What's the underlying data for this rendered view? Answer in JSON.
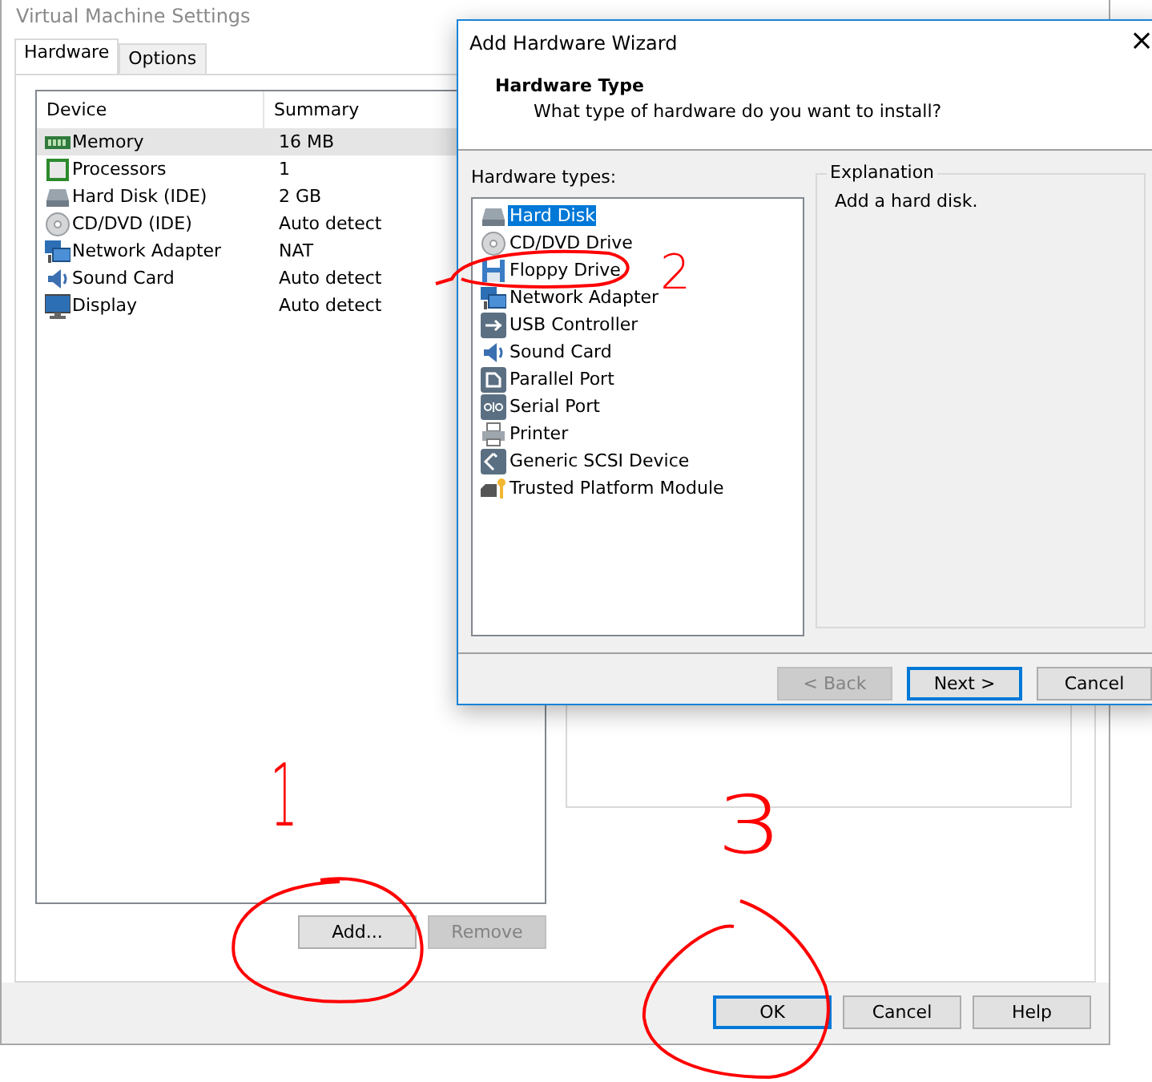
{
  "vm_window": {
    "title": "Virtual Machine Settings",
    "tabs": [
      {
        "label": "Hardware",
        "selected": true
      },
      {
        "label": "Options",
        "selected": false
      }
    ],
    "table": {
      "columns": [
        "Device",
        "Summary"
      ],
      "rows": [
        {
          "kind": "memory",
          "device": "Memory",
          "summary": "16 MB",
          "selected": true
        },
        {
          "kind": "cpu",
          "device": "Processors",
          "summary": "1",
          "selected": false
        },
        {
          "kind": "disk",
          "device": "Hard Disk (IDE)",
          "summary": "2 GB",
          "selected": false
        },
        {
          "kind": "cd",
          "device": "CD/DVD (IDE)",
          "summary": "Auto detect",
          "selected": false
        },
        {
          "kind": "network",
          "device": "Network Adapter",
          "summary": "NAT",
          "selected": false
        },
        {
          "kind": "sound",
          "device": "Sound Card",
          "summary": "Auto detect",
          "selected": false
        },
        {
          "kind": "display",
          "device": "Display",
          "summary": "Auto detect",
          "selected": false
        }
      ]
    },
    "list_buttons": [
      {
        "label": "Add...",
        "disabled": false
      },
      {
        "label": "Remove",
        "disabled": true
      }
    ],
    "buttons": [
      {
        "label": "OK",
        "default": true
      },
      {
        "label": "Cancel",
        "default": false
      },
      {
        "label": "Help",
        "default": false
      }
    ]
  },
  "wizard": {
    "title": "Add Hardware Wizard",
    "close": "×",
    "heading": "Hardware Type",
    "subtitle": "What type of hardware do you want to install?",
    "list_label": "Hardware types:",
    "items": [
      {
        "kind": "disk",
        "label": "Hard Disk",
        "selected": true
      },
      {
        "kind": "cd",
        "label": "CD/DVD Drive",
        "selected": false
      },
      {
        "kind": "floppy",
        "label": "Floppy Drive",
        "selected": false
      },
      {
        "kind": "network",
        "label": "Network Adapter",
        "selected": false
      },
      {
        "kind": "usb",
        "label": "USB Controller",
        "selected": false
      },
      {
        "kind": "sound",
        "label": "Sound Card",
        "selected": false
      },
      {
        "kind": "parallel",
        "label": "Parallel Port",
        "selected": false
      },
      {
        "kind": "serial",
        "label": "Serial Port",
        "selected": false
      },
      {
        "kind": "printer",
        "label": "Printer",
        "selected": false
      },
      {
        "kind": "scsi",
        "label": "Generic SCSI Device",
        "selected": false
      },
      {
        "kind": "tpm",
        "label": "Trusted Platform Module",
        "selected": false
      }
    ],
    "explanation_title": "Explanation",
    "explanation": "Add a hard disk.",
    "buttons": [
      {
        "label": "< Back",
        "disabled": true,
        "default": false
      },
      {
        "label": "Next >",
        "disabled": false,
        "default": true
      },
      {
        "label": "Cancel",
        "disabled": false,
        "default": false
      }
    ]
  },
  "annotations": [
    {
      "label": "1",
      "kind": "one"
    },
    {
      "label": "2",
      "kind": "two"
    },
    {
      "label": "3",
      "kind": "three"
    }
  ]
}
